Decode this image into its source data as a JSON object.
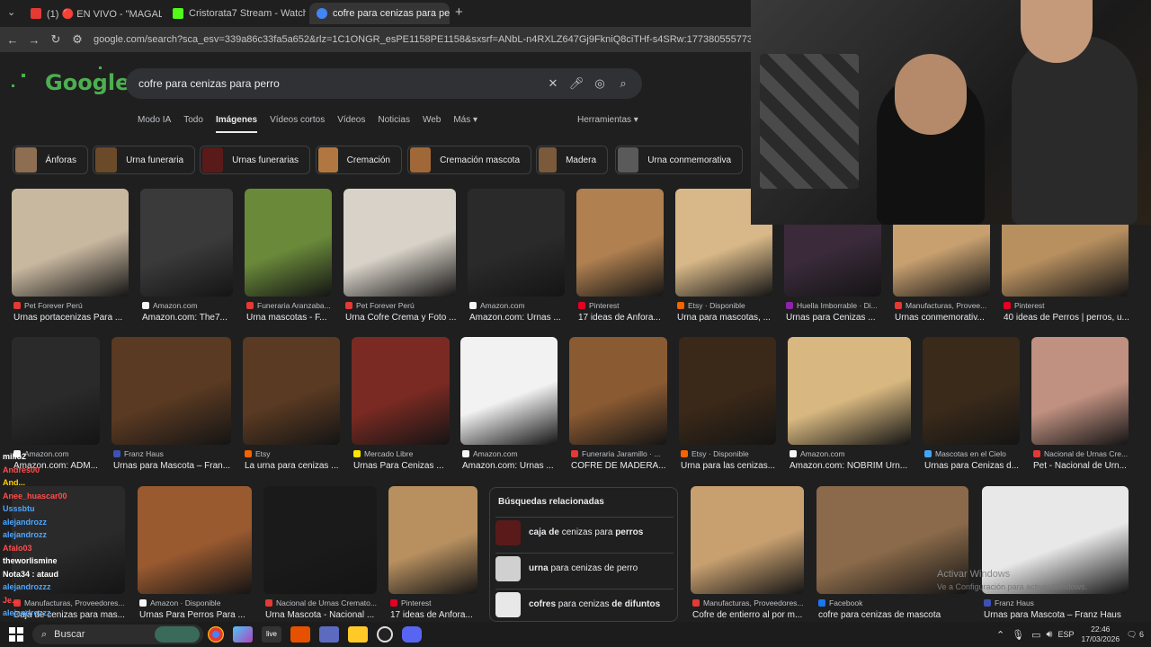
{
  "browser": {
    "tabs": [
      {
        "label": "(1) 🔴 EN VIVO - \"MAGALY TV",
        "color": "#e53935"
      },
      {
        "label": "Cristorata7 Stream - Watch Live",
        "color": "#53fc18"
      },
      {
        "label": "cofre para cenizas para perro -",
        "color": "#4285f4",
        "active": true
      }
    ],
    "new_tab": "+",
    "url": "google.com/search?sca_esv=339a86c33fa5a652&rlz=1C1ONGR_esPE1158PE1158&sxsrf=ANbL-n4RXLZ647Gj9FkniQ8ciTHf-s4SRw:1773805557739&udm=2&fbs=ADc_l-bpk8W4E"
  },
  "search": {
    "logo": "Google",
    "query": "cofre para cenizas para perro",
    "tabs": [
      "Modo IA",
      "Todo",
      "Imágenes",
      "Vídeos cortos",
      "Vídeos",
      "Noticias",
      "Web",
      "Más ▾"
    ],
    "tools": "Herramientas ▾"
  },
  "chips": [
    {
      "label": "Ánforas",
      "color": "#8d6e52"
    },
    {
      "label": "Urna funeraria",
      "color": "#6b4a2a"
    },
    {
      "label": "Urnas funerarias",
      "color": "#5a1a1a"
    },
    {
      "label": "Cremación",
      "color": "#b07840"
    },
    {
      "label": "Cremación mascota",
      "color": "#a06838"
    },
    {
      "label": "Madera",
      "color": "#7a5a3a"
    },
    {
      "label": "Urna conmemorativa",
      "color": "#5a5a5a"
    }
  ],
  "row1": [
    {
      "source": "Pet Forever Perú",
      "title": "Urnas portacenizas Para ...",
      "color": "#c9b8a0",
      "icon": "#e53935"
    },
    {
      "source": "Amazon.com",
      "title": "Amazon.com: The7...",
      "color": "#3a3a3a",
      "icon": "#f5f5f5"
    },
    {
      "source": "Funeraria Aranzaba...",
      "title": "Urna mascotas - F...",
      "color": "#6a8a3a",
      "icon": "#e53935"
    },
    {
      "source": "Pet Forever Perú",
      "title": "Urna Cofre Crema y Foto ...",
      "color": "#d8d2c8",
      "icon": "#e53935"
    },
    {
      "source": "Amazon.com",
      "title": "Amazon.com: Urnas ...",
      "color": "#2a2a2a",
      "icon": "#f5f5f5"
    },
    {
      "source": "Pinterest",
      "title": "17 ideas de Anfora...",
      "color": "#b08050",
      "icon": "#e60023"
    },
    {
      "source": "Etsy · Disponible",
      "title": "Urna para mascotas, ...",
      "color": "#d8b888",
      "icon": "#f56400"
    },
    {
      "source": "Huella Imborrable · Di...",
      "title": "Urnas para Cenizas ...",
      "color": "#3a2a3a",
      "icon": "#8e24aa"
    },
    {
      "source": "Manufacturas, Provee...",
      "title": "Urnas conmemorativ...",
      "color": "#c8a070",
      "icon": "#e53935"
    },
    {
      "source": "Pinterest",
      "title": "40 ideas de Perros | perros, u...",
      "color": "#b89060",
      "icon": "#e60023"
    }
  ],
  "row2": [
    {
      "source": "Amazon.com",
      "title": "Amazon.com: ADM...",
      "color": "#2a2a2a",
      "icon": "#f5f5f5"
    },
    {
      "source": "Franz Haus",
      "title": "Urnas para Mascota – Fran...",
      "color": "#5a3a22",
      "icon": "#3f51b5"
    },
    {
      "source": "Etsy",
      "title": "La urna para cenizas ...",
      "color": "#5a3a22",
      "icon": "#f56400"
    },
    {
      "source": "Mercado Libre",
      "title": "Urnas Para Cenizas ...",
      "color": "#7a2a22",
      "icon": "#ffe600"
    },
    {
      "source": "Amazon.com",
      "title": "Amazon.com: Urnas ...",
      "color": "#f2f2f2",
      "icon": "#f5f5f5"
    },
    {
      "source": "Funeraria Jaramillo · ...",
      "title": "COFRE DE MADERA...",
      "color": "#8a5a32",
      "icon": "#e53935"
    },
    {
      "source": "Etsy · Disponible",
      "title": "Urna para las cenizas...",
      "color": "#3a2818",
      "icon": "#f56400"
    },
    {
      "source": "Amazon.com",
      "title": "Amazon.com: NOBRIM Urn...",
      "color": "#d8b880",
      "icon": "#f5f5f5"
    },
    {
      "source": "Mascotas en el Cielo",
      "title": "Urnas para Cenizas d...",
      "color": "#3a2a1a",
      "icon": "#42a5f5"
    },
    {
      "source": "Nacional de Urnas Cre...",
      "title": "Pet - Nacional de Urn...",
      "color": "#c09080",
      "icon": "#e53935"
    }
  ],
  "row3": [
    {
      "source": "Manufacturas, Proveedores...",
      "title": "Caja de cenizas para mas...",
      "color": "#2a2a2a",
      "icon": "#e53935"
    },
    {
      "source": "Amazon · Disponible",
      "title": "Urnas Para Perros Para ...",
      "color": "#9a5a30",
      "icon": "#f5f5f5"
    },
    {
      "source": "Nacional de Urnas Cremato...",
      "title": "Urna Mascota - Nacional ...",
      "color": "#1a1a1a",
      "icon": "#e53935"
    },
    {
      "source": "Pinterest",
      "title": "17 ideas de Anfora...",
      "color": "#b89060",
      "icon": "#e60023"
    },
    {
      "source": "Manufacturas, Proveedores...",
      "title": "Cofre de entierro al por m...",
      "color": "#c8a070",
      "icon": "#e53935"
    },
    {
      "source": "Facebook",
      "title": "cofre para cenizas de mascota",
      "color": "#8a6a4a",
      "icon": "#1877f2"
    },
    {
      "source": "Franz Haus",
      "title": "Urnas para Mascota – Franz Haus",
      "color": "#e8e8e8",
      "icon": "#3f51b5"
    }
  ],
  "related": {
    "heading": "Búsquedas relacionadas",
    "items": [
      {
        "pre": "caja de",
        "mid": "cenizas para",
        "post": "perros"
      },
      {
        "pre": "urna",
        "mid": "para cenizas",
        "post": "de perro"
      },
      {
        "pre": "cofres",
        "mid": "para cenizas",
        "post": "de difuntos"
      }
    ]
  },
  "chat": [
    {
      "name": "millo2",
      "color": "#ffffff"
    },
    {
      "name": "Andres00",
      "color": "#ff4d4d"
    },
    {
      "name": "And...",
      "color": "#ffd000"
    },
    {
      "name": "Anee_huascar00",
      "color": "#ff4d4d"
    },
    {
      "name": "Usssbtu",
      "color": "#4da6ff"
    },
    {
      "name": "alejandrozz",
      "color": "#4da6ff"
    },
    {
      "name": "alejandrozz",
      "color": "#4da6ff"
    },
    {
      "name": "Afalo03",
      "color": "#ff4d4d"
    },
    {
      "name": "theworlismine",
      "color": "#ffffff"
    },
    {
      "name": "Nota34 : ataud",
      "color": "#ffffff"
    },
    {
      "name": "alejandrozzz",
      "color": "#4da6ff"
    },
    {
      "name": "Je...",
      "color": "#ff4d4d"
    },
    {
      "name": "alejandrozzz",
      "color": "#4da6ff"
    }
  ],
  "watermark": {
    "line1": "Activar Windows",
    "line2": "Ve a Configuración para activar Windows."
  },
  "taskbar": {
    "search": "Buscar",
    "lang": "ESP",
    "time": "22:46",
    "date": "17/03/2026",
    "notif": "6"
  }
}
